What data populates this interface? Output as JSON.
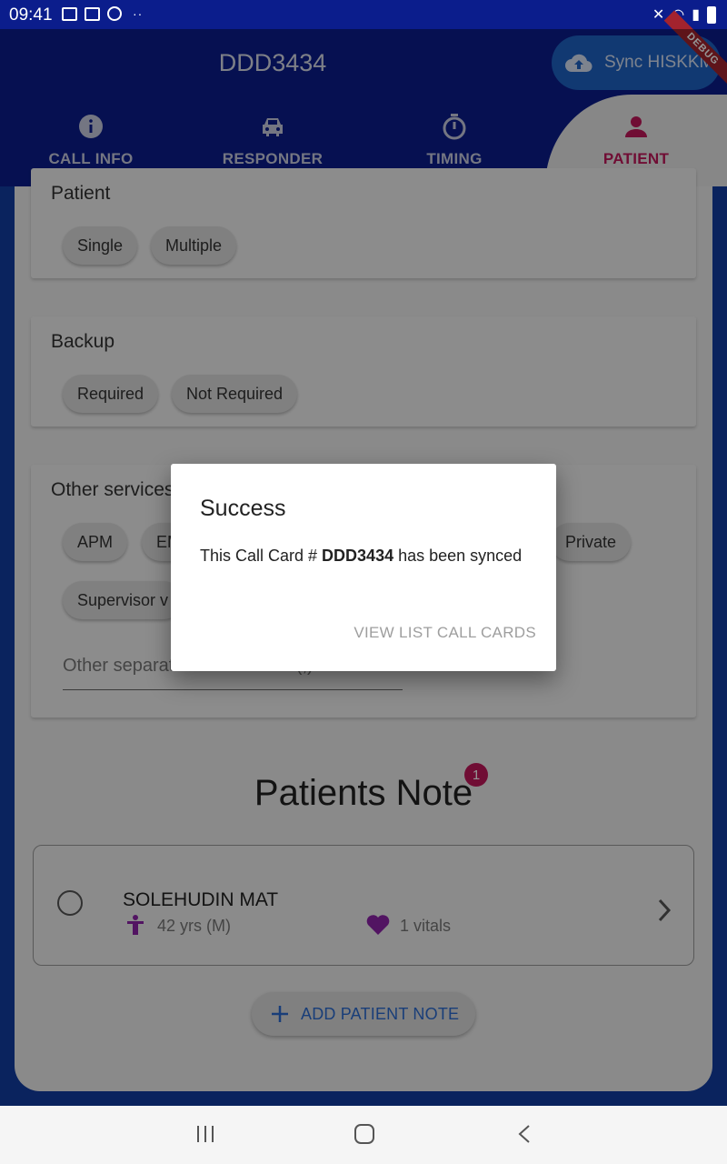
{
  "status_bar": {
    "time": "09:41",
    "dots": "··"
  },
  "app_bar": {
    "title": "DDD3434",
    "sync_button": "Sync HISKKM",
    "debug_banner": "DEBUG",
    "tabs": [
      {
        "label": "CALL INFO",
        "icon": "info-icon"
      },
      {
        "label": "RESPONDER",
        "icon": "car-icon"
      },
      {
        "label": "TIMING",
        "icon": "stopwatch-icon"
      },
      {
        "label": "PATIENT",
        "icon": "person-icon",
        "active": true
      }
    ]
  },
  "patient_section": {
    "title": "Patient",
    "chips": [
      "Single",
      "Multiple"
    ]
  },
  "backup_section": {
    "title": "Backup",
    "chips": [
      "Required",
      "Not Required"
    ]
  },
  "other_services": {
    "title": "Other services",
    "chips": [
      "APM",
      "EM",
      "Private",
      "Supervisor v"
    ],
    "input_placeholder": "Other separated with comma(,)"
  },
  "patients_note": {
    "title": "Patients Note",
    "badge_count": "1",
    "patient": {
      "name": "SOLEHUDIN MAT",
      "age": "42 yrs (M)",
      "vitals": "1 vitals"
    },
    "add_button": "ADD PATIENT NOTE"
  },
  "dialog": {
    "title": "Success",
    "message_prefix": "This Call Card # ",
    "message_id": "DDD3434",
    "message_suffix": " has been synced",
    "action": "VIEW LIST CALL CARDS"
  },
  "colors": {
    "primary": "#0b1d8c",
    "accent": "#c2185b",
    "link": "#2c6bd0",
    "sync_button": "#1e63c4"
  }
}
